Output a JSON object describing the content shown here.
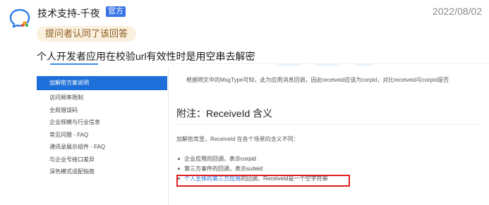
{
  "header": {
    "author": "技术支持-千夜",
    "badge": "官方",
    "date": "2022/08/02",
    "accepted": "提问者认同了该回答"
  },
  "answer": {
    "text": "个人开发者应用在校验url有效性时是用空串去解密"
  },
  "sidebar": {
    "items": [
      {
        "label": "加解密方案说明",
        "active": true
      },
      {
        "label": "访问频率限制"
      },
      {
        "label": "全局错误码"
      },
      {
        "label": "企业规模与行业信息"
      },
      {
        "label": "常见问题 - FAQ"
      },
      {
        "label": "通讯录展示组件 - FAQ"
      },
      {
        "label": "与企业号接口差异"
      },
      {
        "label": "深色模式适配指南"
      }
    ]
  },
  "doc": {
    "top_text": "根据明文中的MsgType可知，此为应用消息回调，因此receiveid应该为corpid，对比receiveid与corpid是否",
    "title": "附注：ReceiveId 含义",
    "desc": "加解密库里，ReceiveId 在各个场景的含义不同：",
    "bullets": [
      {
        "text": "企业应用的回调，表示corpid"
      },
      {
        "text": "第三方事件的回调，表示suiteid"
      },
      {
        "link": "个人主体的第三方应用",
        "text": "的回调，ReceiveId是一个空字符串"
      }
    ]
  },
  "colors": {
    "accent": "#1e6fd9",
    "badge": "#3a73e6",
    "highlight": "#e01e1e",
    "accepted_bg": "#fbf0de"
  },
  "icons": {
    "avatar": "chat-bubble-icon"
  }
}
